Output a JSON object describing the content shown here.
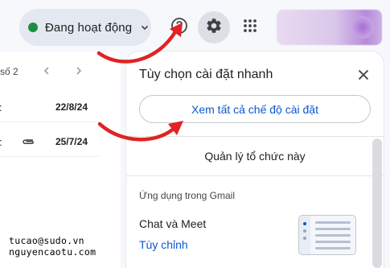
{
  "status": {
    "label": "Đang hoạt động",
    "dot_color": "#1e8e3e"
  },
  "header": {
    "icons": [
      "help-icon",
      "gear-icon",
      "apps-grid-icon"
    ]
  },
  "mail_list": {
    "pager_text": "số 2",
    "rows": [
      {
        "fragment": ":",
        "date": "22/8/24",
        "has_attachment": false
      },
      {
        "fragment": ":",
        "date": "25/7/24",
        "has_attachment": true
      }
    ]
  },
  "quick_settings": {
    "title": "Tùy chọn cài đặt nhanh",
    "see_all_label": "Xem tất cả chế độ cài đặt",
    "manage_org_label": "Quản lý tổ chức này",
    "section_apps": "Ứng dụng trong Gmail",
    "chat_meet_label": "Chat và Meet",
    "customize_label": "Tùy chỉnh"
  },
  "colors": {
    "accent": "#0b57d0",
    "arrow": "#e02323"
  },
  "watermark": {
    "line1": "tucao@sudo.vn",
    "line2": "nguyencaotu.com"
  }
}
